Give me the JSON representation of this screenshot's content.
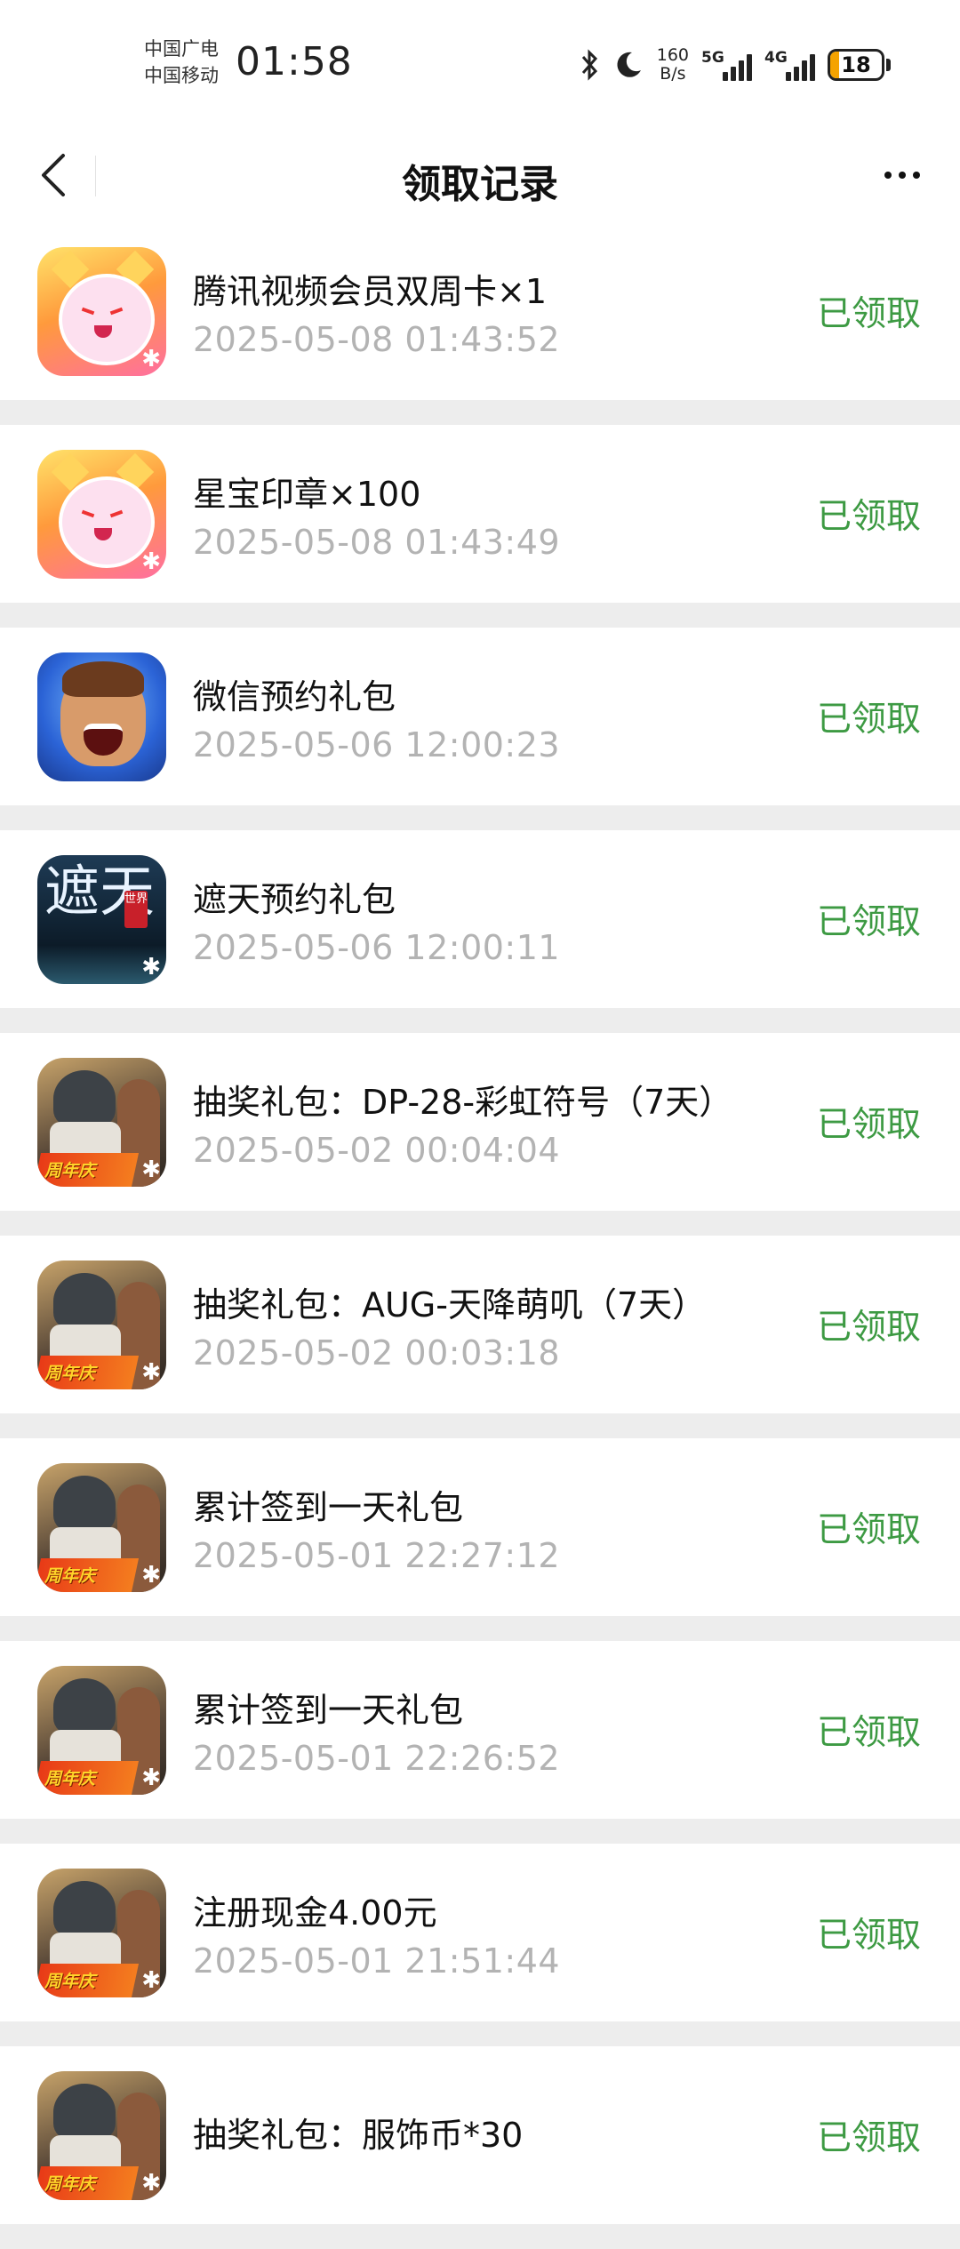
{
  "status": {
    "carrier1": "中国广电",
    "carrier2": "中国移动",
    "time": "01:58",
    "speed_value": "160",
    "speed_unit": "B/s",
    "net1": "5G",
    "net2": "4G",
    "battery": "18",
    "battery_level": 0.18
  },
  "nav": {
    "title": "领取记录"
  },
  "records": [
    {
      "name": "腾讯视频会员双周卡×1",
      "time": "2025-05-08 01:43:52",
      "state": "已领取"
    },
    {
      "name": "星宝印章×100",
      "time": "2025-05-08 01:43:49",
      "state": "已领取"
    },
    {
      "name": "微信预约礼包",
      "time": "2025-05-06 12:00:23",
      "state": "已领取"
    },
    {
      "name": "遮天预约礼包",
      "time": "2025-05-06 12:00:11",
      "state": "已领取"
    },
    {
      "name": "抽奖礼包：DP-28-彩虹符号（7天）",
      "time": "2025-05-02 00:04:04",
      "state": "已领取"
    },
    {
      "name": "抽奖礼包：AUG-天降萌叽（7天）",
      "time": "2025-05-02 00:03:18",
      "state": "已领取"
    },
    {
      "name": "累计签到一天礼包",
      "time": "2025-05-01 22:27:12",
      "state": "已领取"
    },
    {
      "name": "累计签到一天礼包",
      "time": "2025-05-01 22:26:52",
      "state": "已领取"
    },
    {
      "name": "注册现金4.00元",
      "time": "2025-05-01 21:51:44",
      "state": "已领取"
    },
    {
      "name": "抽奖礼包：服饰币*30",
      "time": "",
      "state": "已领取"
    }
  ],
  "icons": {
    "zt_char": "遮天",
    "zt_seal": "世界",
    "pubg_badge": "周年庆"
  },
  "colors": {
    "state_green": "#3d9a43",
    "background": "#ededed"
  }
}
